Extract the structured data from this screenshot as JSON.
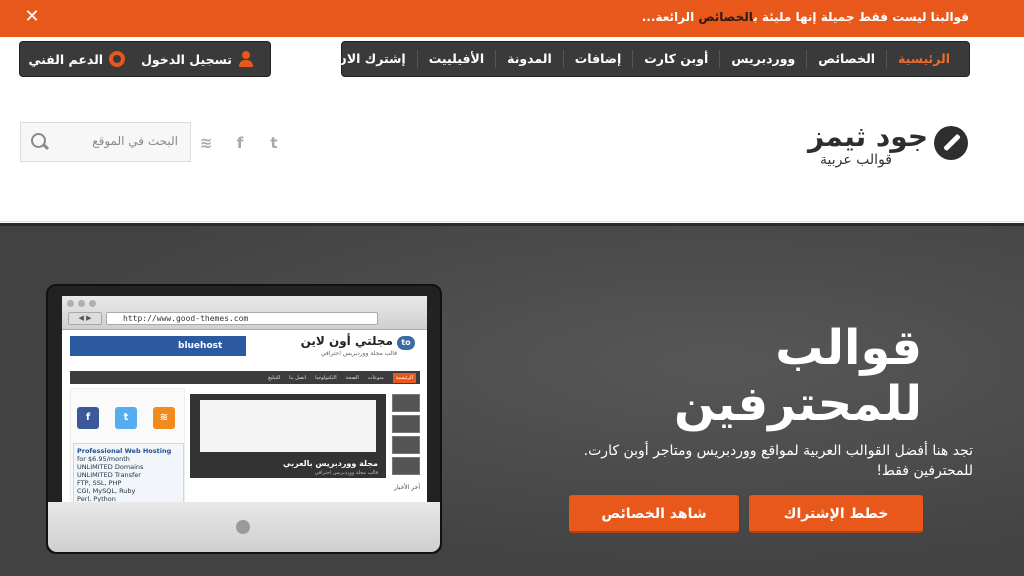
{
  "topbar": {
    "message_prefix": "قوالبنا ليست فقط جميلة إنها مليئة ب",
    "message_highlight": "الخصائص",
    "message_suffix": " الرائعة...",
    "close_label": "✕"
  },
  "main_nav": {
    "items": [
      {
        "label": "الرئيسية",
        "active": true
      },
      {
        "label": "الخصائص"
      },
      {
        "label": "ووردبريس"
      },
      {
        "label": "أوبن كارت"
      },
      {
        "label": "إضافات"
      },
      {
        "label": "المدونة"
      },
      {
        "label": "الأفيلييت"
      },
      {
        "label": "إشترك الان"
      }
    ]
  },
  "user_nav": {
    "login_label": "تسجيل الدخول",
    "support_label": "الدعم الفني"
  },
  "header": {
    "logo_name": "جود ثيمز",
    "logo_tagline": "قوالب عربية",
    "social": {
      "twitter": "t",
      "facebook": "f",
      "rss": "≋"
    },
    "search_placeholder": "البحث في الموقع"
  },
  "hero": {
    "title_line1": "قوالب",
    "title_line2": "للمحترفين",
    "description": "تجد هنا أفضل القوالب العربية لمواقع ووردبريس ومتاجر أوبن كارت. للمحترفين فقط!",
    "btn_plans": "خطط الإشتراك",
    "btn_features": "شاهد الخصائص"
  },
  "preview": {
    "url": "http://www.good-themes.com",
    "site_logo": "مجلتي أون لاين",
    "site_tagline": "قالب مجلة ووردبريس احترافي",
    "ad_brand": "bluehost",
    "site_nav": [
      "الرئيسية",
      "منوعات",
      "الصحة",
      "التكنولوجيا",
      "اتصل بنا",
      "للتبليغ"
    ],
    "slider_caption": "مجلة ووردبريس بالعربي",
    "slider_subcaption": "قالب مجلة ووردبريس احترافي",
    "hosting_ad_title": "Professional Web Hosting",
    "hosting_ad_price": "for $6.95/month",
    "hosting_ad_lines": [
      "UNLIMITED Domains",
      "UNLIMITED Transfer",
      "FTP, SSL, PHP",
      "CGI, MySQL, Ruby",
      "Perl, Python"
    ],
    "latest_label": "آخر الأخبار"
  },
  "colors": {
    "accent": "#e9581b",
    "nav_bg": "#3a3a3a",
    "hero_bg": "#4a4a4a"
  }
}
